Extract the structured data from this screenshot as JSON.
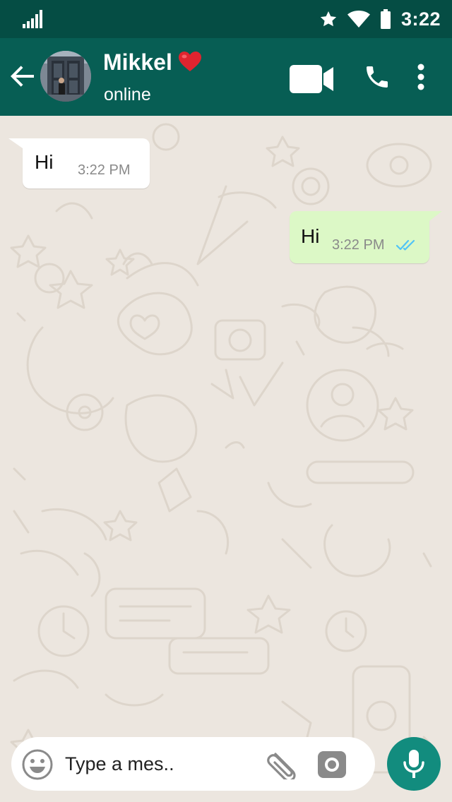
{
  "status_bar": {
    "time": "3:22",
    "icons": [
      "signal-icon",
      "star-icon",
      "wifi-icon",
      "battery-icon"
    ]
  },
  "header": {
    "contact_name": "Mikkel",
    "contact_emoji": "heart-icon",
    "contact_status": "online",
    "icons": [
      "back-arrow-icon",
      "video-call-icon",
      "voice-call-icon",
      "more-options-icon"
    ]
  },
  "messages": [
    {
      "direction": "incoming",
      "text": "Hi",
      "time": "3:22 PM"
    },
    {
      "direction": "outgoing",
      "text": "Hi",
      "time": "3:22 PM",
      "status": "read"
    }
  ],
  "composer": {
    "placeholder": "Type a mes..",
    "value": "",
    "icons": [
      "emoji-icon",
      "paperclip-icon",
      "camera-icon",
      "microphone-icon"
    ]
  },
  "colors": {
    "status_bar": "#054D44",
    "app_bar": "#075E54",
    "chat_background": "#ECE5DD",
    "incoming_bubble": "#FFFFFF",
    "outgoing_bubble": "#DCF8C6",
    "read_ticks": "#4FC3F7",
    "mic_button": "#128C7E"
  }
}
